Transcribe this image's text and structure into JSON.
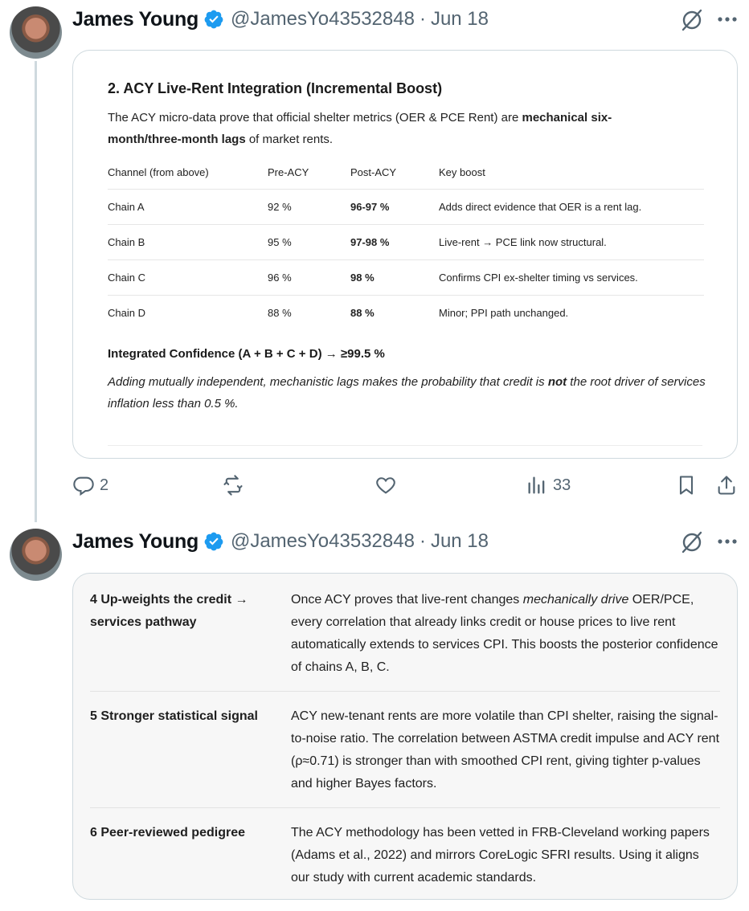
{
  "tweet1": {
    "author_name": "James Young",
    "handle": "@JamesYo43532848",
    "separator": "·",
    "date": "Jun 18",
    "doc": {
      "title": "2. ACY Live-Rent Integration (Incremental Boost)",
      "intro_plain": "The ACY micro-data prove that official shelter metrics (OER & PCE Rent) are ",
      "intro_bold": "mechanical six-month/three-month lags",
      "intro_tail": " of market rents.",
      "table": {
        "headers": [
          "Channel (from above)",
          "Pre-ACY",
          "Post-ACY",
          "Key boost"
        ],
        "rows": [
          [
            "Chain A",
            "92 %",
            "96-97 %",
            "Adds direct evidence that OER is a rent lag."
          ],
          [
            "Chain B",
            "95 %",
            "97-98 %",
            "Live-rent → PCE link now structural."
          ],
          [
            "Chain C",
            "96 %",
            "98 %",
            "Confirms CPI ex-shelter timing vs services."
          ],
          [
            "Chain D",
            "88 %",
            "88 %",
            "Minor; PPI path unchanged."
          ]
        ]
      },
      "integrated": "Integrated Confidence (A + B + C + D) → ≥99.5 %",
      "note_plain": "Adding mutually independent, mechanistic lags makes the probability that credit is ",
      "note_bold": "not",
      "note_tail": " the root driver of services inflation less than 0.5 %."
    },
    "actions": {
      "replies": "2",
      "views": "33"
    }
  },
  "tweet2": {
    "author_name": "James Young",
    "handle": "@JamesYo43532848",
    "separator": "·",
    "date": "Jun 18",
    "rows": [
      {
        "key": "4 Up-weights the credit → services pathway",
        "value_plain_1": "Once ACY proves that live-rent changes ",
        "value_italic": "mechanically drive",
        "value_plain_2": " OER/PCE, every correlation that already links credit or house prices to live rent automatically extends to services CPI. This boosts the posterior confidence of chains A, B, C."
      },
      {
        "key": "5 Stronger statistical signal",
        "value": "ACY new-tenant rents are more volatile than CPI shelter, raising the signal-to-noise ratio. The correlation between ASTMA credit impulse and ACY rent (ρ≈0.71) is stronger than with smoothed CPI rent, giving tighter p-values and higher Bayes factors."
      },
      {
        "key": "6 Peer-reviewed pedigree",
        "value": "The ACY methodology has been vetted in FRB-Cleveland working papers (Adams et al., 2022) and mirrors CoreLogic SFRI results. Using it aligns our study with current academic standards."
      }
    ]
  },
  "colors": {
    "verified": "#1d9bf0",
    "muted": "#536471",
    "border": "#cfd9de"
  }
}
